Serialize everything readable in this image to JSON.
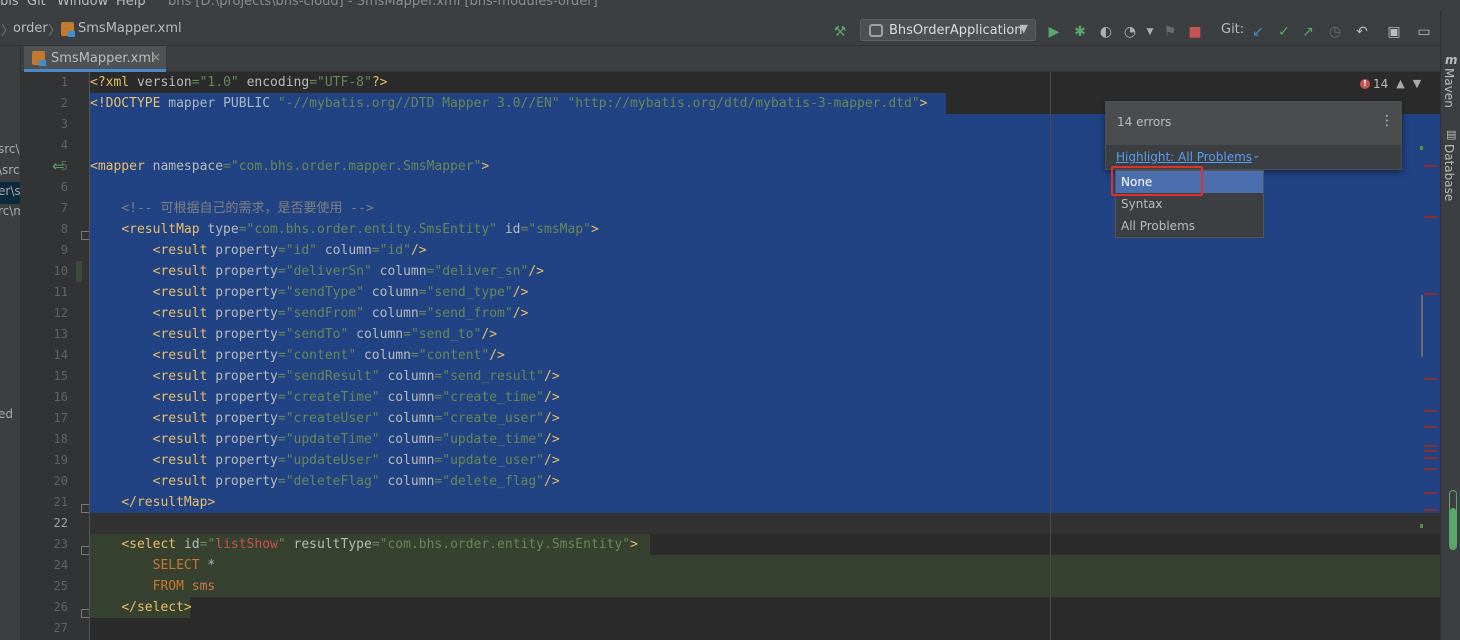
{
  "menu": {
    "items": [
      "bis",
      "Git",
      "Window",
      "Help"
    ],
    "window_title": "bhs [D:\\projects\\bhs-cloud] - SmsMapper.xml [bhs-modules-order]"
  },
  "breadcrumb": {
    "items": [
      "order",
      "SmsMapper.xml"
    ]
  },
  "toolbar": {
    "run_config": "BhsOrderApplication",
    "git_label": "Git:"
  },
  "left_panel": {
    "fragments": [
      "src\\",
      "\\src",
      "er\\s",
      "rc\\m",
      "ed"
    ]
  },
  "tabs": [
    {
      "label": "SmsMapper.xml",
      "close": "×"
    }
  ],
  "editor": {
    "line_numbers": [
      "1",
      "2",
      "3",
      "4",
      "5",
      "6",
      "7",
      "8",
      "9",
      "10",
      "11",
      "12",
      "13",
      "14",
      "15",
      "16",
      "17",
      "18",
      "19",
      "20",
      "21",
      "22",
      "23",
      "24",
      "25",
      "26",
      "27"
    ],
    "current_line": "22"
  },
  "inspection": {
    "error_count": "14",
    "popup_title": "14 errors",
    "highlight_label": "Highlight: All Problems",
    "options": [
      "None",
      "Syntax",
      "All Problems"
    ],
    "selected_option": "None"
  },
  "right_tools": {
    "maven": "Maven",
    "database": "Database"
  },
  "colors": {
    "selection": "#214283",
    "error": "#c75450",
    "highlight_link": "#589df6",
    "annotation_box": "#e0312a"
  }
}
